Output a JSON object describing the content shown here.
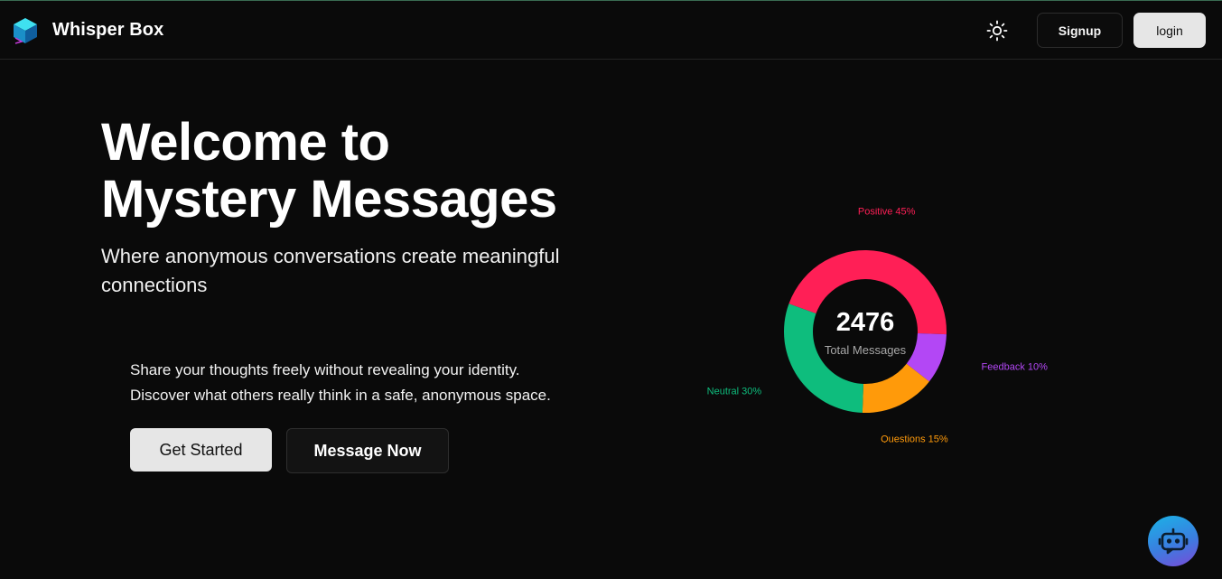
{
  "header": {
    "brand": "Whisper Box",
    "signup_label": "Signup",
    "login_label": "login"
  },
  "hero": {
    "title_line1": "Welcome to",
    "title_line2": "Mystery Messages",
    "subtitle": "Where anonymous conversations create meaningful connections",
    "desc_line1": "Share your thoughts freely without revealing your identity.",
    "desc_line2": "Discover what others really think in a safe, anonymous space.",
    "get_started_label": "Get Started",
    "message_now_label": "Message Now"
  },
  "chart_data": {
    "type": "pie",
    "center_value": "2476",
    "center_label": "Total Messages",
    "slices": [
      {
        "label": "Positive 45%",
        "value": 45,
        "color": "#ff1f56"
      },
      {
        "label": "Feedback 10%",
        "value": 10,
        "color": "#b347f5"
      },
      {
        "label": "Questions 15%",
        "value": 15,
        "color": "#ff9a0a"
      },
      {
        "label": "Neutral 30%",
        "value": 30,
        "color": "#0ebd7d"
      }
    ]
  },
  "colors": {
    "background": "#0a0a0a",
    "accent_positive": "#ff1f56",
    "accent_feedback": "#b347f5",
    "accent_questions": "#ff9a0a",
    "accent_neutral": "#0ebd7d"
  },
  "icons": {
    "logo": "cube-logo-icon",
    "theme": "sun-icon",
    "assistant": "bot-icon"
  }
}
